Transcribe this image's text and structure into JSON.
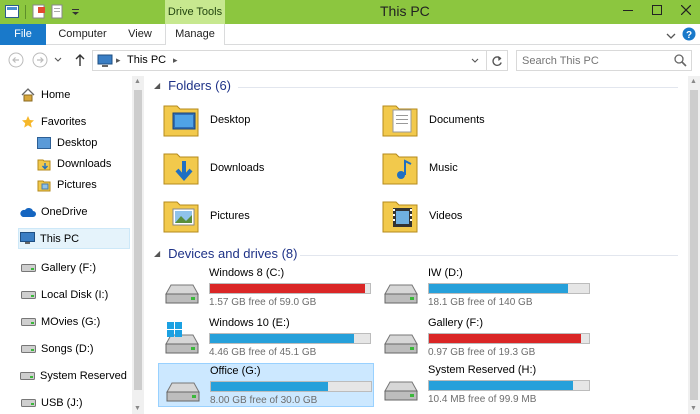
{
  "window": {
    "title": "This PC",
    "context_tab": "Drive Tools"
  },
  "ribbon": {
    "tabs": [
      "File",
      "Computer",
      "View",
      "Manage"
    ]
  },
  "address": {
    "crumb": "This PC"
  },
  "search": {
    "placeholder": "Search This PC"
  },
  "colors": {
    "titlebar": "#8cc63f",
    "file_tab": "#1979ca",
    "bar_ok": "#26a0da",
    "bar_low": "#da2626"
  },
  "nav": {
    "items": [
      {
        "label": "Home",
        "icon": "home-icon"
      },
      {
        "label": "Favorites",
        "icon": "star-icon"
      },
      {
        "label": "Desktop",
        "icon": "desktop-icon"
      },
      {
        "label": "Downloads",
        "icon": "downloads-folder-icon"
      },
      {
        "label": "Pictures",
        "icon": "pictures-folder-icon"
      },
      {
        "label": "OneDrive",
        "icon": "cloud-icon"
      },
      {
        "label": "This PC",
        "icon": "computer-icon"
      },
      {
        "label": "Gallery (F:)",
        "icon": "drive-icon"
      },
      {
        "label": "Local Disk (I:)",
        "icon": "drive-icon"
      },
      {
        "label": "MOvies (G:)",
        "icon": "drive-icon"
      },
      {
        "label": "Songs (D:)",
        "icon": "drive-icon"
      },
      {
        "label": "System Reserved (H",
        "icon": "drive-icon"
      },
      {
        "label": "USB (J:)",
        "icon": "usb-drive-icon"
      }
    ]
  },
  "folders": {
    "header": "Folders (6)",
    "items": [
      {
        "label": "Desktop"
      },
      {
        "label": "Documents"
      },
      {
        "label": "Downloads"
      },
      {
        "label": "Music"
      },
      {
        "label": "Pictures"
      },
      {
        "label": "Videos"
      }
    ]
  },
  "drives": {
    "header": "Devices and drives (8)",
    "items": [
      {
        "label": "Windows 8 (C:)",
        "free": "1.57 GB free of 59.0 GB",
        "used_fraction": 0.97,
        "status": "low"
      },
      {
        "label": "IW (D:)",
        "free": "18.1 GB free of 140 GB",
        "used_fraction": 0.87,
        "status": "ok"
      },
      {
        "label": "Windows 10 (E:)",
        "free": "4.46 GB free of 45.1 GB",
        "used_fraction": 0.9,
        "status": "ok"
      },
      {
        "label": "Gallery (F:)",
        "free": "0.97 GB free of 19.3 GB",
        "used_fraction": 0.95,
        "status": "low"
      },
      {
        "label": "Office (G:)",
        "free": "8.00 GB free of 30.0 GB",
        "used_fraction": 0.73,
        "status": "ok"
      },
      {
        "label": "System Reserved (H:)",
        "free": "10.4 MB free of 99.9 MB",
        "used_fraction": 0.9,
        "status": "ok"
      }
    ]
  }
}
